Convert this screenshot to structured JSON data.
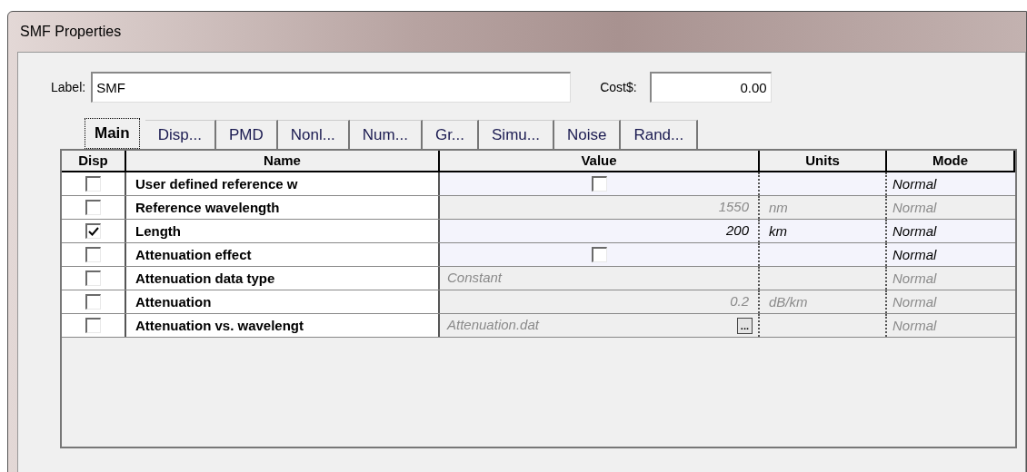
{
  "window": {
    "title": "SMF Properties"
  },
  "label_field": {
    "label": "Label:",
    "value": "SMF"
  },
  "cost_field": {
    "label": "Cost$:",
    "value": "0.00"
  },
  "tabs": [
    {
      "label": "Main",
      "selected": true
    },
    {
      "label": "Disp...",
      "selected": false
    },
    {
      "label": "PMD",
      "selected": false
    },
    {
      "label": "Nonl...",
      "selected": false
    },
    {
      "label": "Num...",
      "selected": false
    },
    {
      "label": "Gr...",
      "selected": false
    },
    {
      "label": "Simu...",
      "selected": false
    },
    {
      "label": "Noise",
      "selected": false
    },
    {
      "label": "Rand...",
      "selected": false
    }
  ],
  "table": {
    "columns": [
      "Disp",
      "Name",
      "Value",
      "Units",
      "Mode"
    ],
    "rows": [
      {
        "disp_checked": false,
        "name": "User defined reference w",
        "kind": "checkbox",
        "value_checked": false,
        "units": "",
        "mode": "Normal",
        "disabled": false
      },
      {
        "disp_checked": false,
        "name": "Reference wavelength",
        "kind": "number",
        "value": "1550",
        "units": "nm",
        "mode": "Normal",
        "disabled": true
      },
      {
        "disp_checked": true,
        "name": "Length",
        "kind": "number",
        "value": "200",
        "units": "km",
        "mode": "Normal",
        "disabled": false
      },
      {
        "disp_checked": false,
        "name": "Attenuation effect",
        "kind": "checkbox",
        "value_checked": false,
        "units": "",
        "mode": "Normal",
        "disabled": false
      },
      {
        "disp_checked": false,
        "name": "Attenuation data type",
        "kind": "text",
        "value": "Constant",
        "units": "",
        "mode": "Normal",
        "disabled": true
      },
      {
        "disp_checked": false,
        "name": "Attenuation",
        "kind": "number",
        "value": "0.2",
        "units": "dB/km",
        "mode": "Normal",
        "disabled": true
      },
      {
        "disp_checked": false,
        "name": "Attenuation vs. wavelengt",
        "kind": "file",
        "value": "Attenuation.dat",
        "button": "...",
        "units": "",
        "mode": "Normal",
        "disabled": true
      }
    ]
  }
}
